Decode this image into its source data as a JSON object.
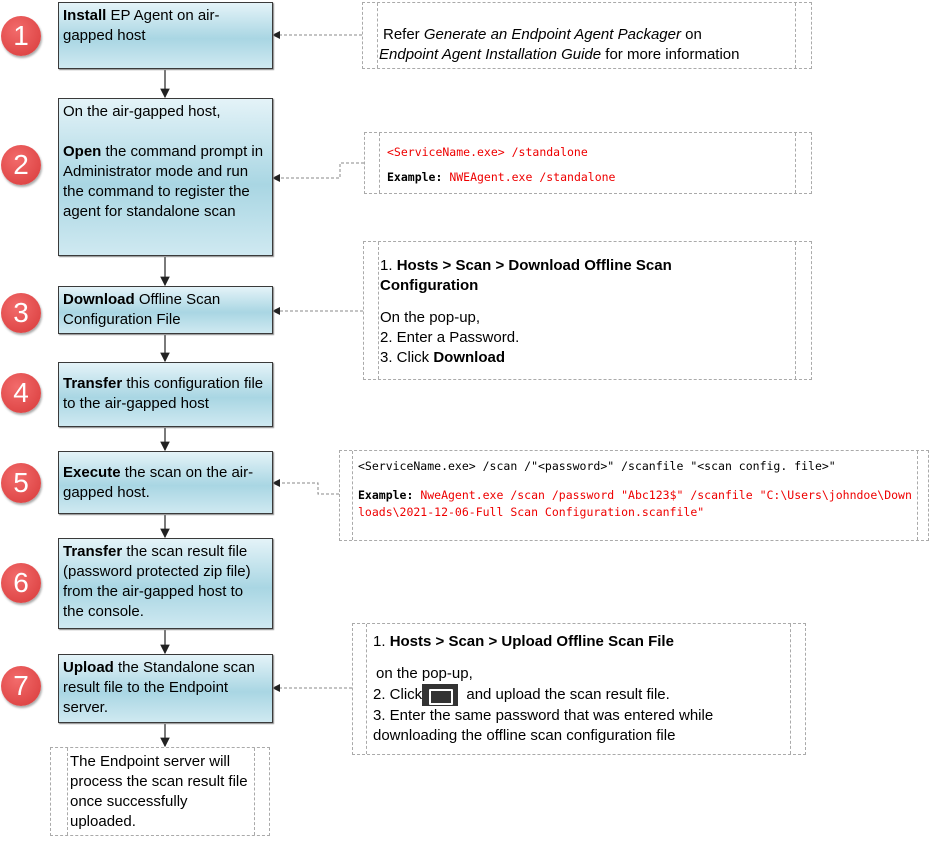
{
  "steps": [
    {
      "num": "1",
      "bold": "Install",
      "text": " EP Agent on air-gapped host"
    },
    {
      "num": "2",
      "pre": "On the air-gapped host,",
      "bold": "Open",
      "text": " the command prompt in Administrator mode and run the command to register the agent for standalone scan"
    },
    {
      "num": "3",
      "bold": "Download",
      "text": " Offline Scan Configuration File"
    },
    {
      "num": "4",
      "bold": "Transfer",
      "text": " this configuration file to the air-gapped host"
    },
    {
      "num": "5",
      "bold": "Execute",
      "text": " the scan on the air-gapped host."
    },
    {
      "num": "6",
      "bold": "Transfer",
      "text": " the scan result file (password protected zip file) from the air-gapped host to the console."
    },
    {
      "num": "7",
      "bold": "Upload",
      "text": " the Standalone scan result file to the Endpoint server."
    }
  ],
  "final": "The Endpoint server will process the scan result file once successfully uploaded.",
  "notes": {
    "n1": {
      "a": "Refer ",
      "i1": "Generate an Endpoint Agent Packager",
      "b": " on ",
      "i2": "Endpoint Agent Installation Guide",
      "c": " for more information"
    },
    "n2": {
      "cmd": "<ServiceName.exe> /standalone",
      "ex_label": "Example:",
      "ex": " NWEAgent.exe /standalone"
    },
    "n3": {
      "l1": "1. ",
      "b1": "Hosts > Scan > Download Offline Scan Configuration",
      "l2": "On the pop-up,",
      "l3": "2. Enter a Password.",
      "l4": "3. Click ",
      "b4": "Download"
    },
    "n5": {
      "cmd": "<ServiceName.exe> /scan /\"<password>\" /scanfile \"<scan config. file>\"",
      "ex_label": "Example:",
      "ex": " NweAgent.exe /scan /password \"Abc123$\" /scanfile \"C:\\Users\\johndoe\\Downloads\\2021-12-06-Full Scan Configuration.scanfile\""
    },
    "n7": {
      "l1": "1. ",
      "b1": "Hosts > Scan > Upload Offline Scan File",
      "l2": "on the pop-up,",
      "l3a": "2. Click",
      "l3b": " and upload the scan result file.",
      "l4": "3. Enter the same password that was entered while downloading the offline scan configuration file",
      "icon": "folder-open-icon"
    }
  },
  "colors": {
    "step_fill": "#a9d6e3",
    "badge": "#d83a3a",
    "command_red": "#e00000"
  }
}
